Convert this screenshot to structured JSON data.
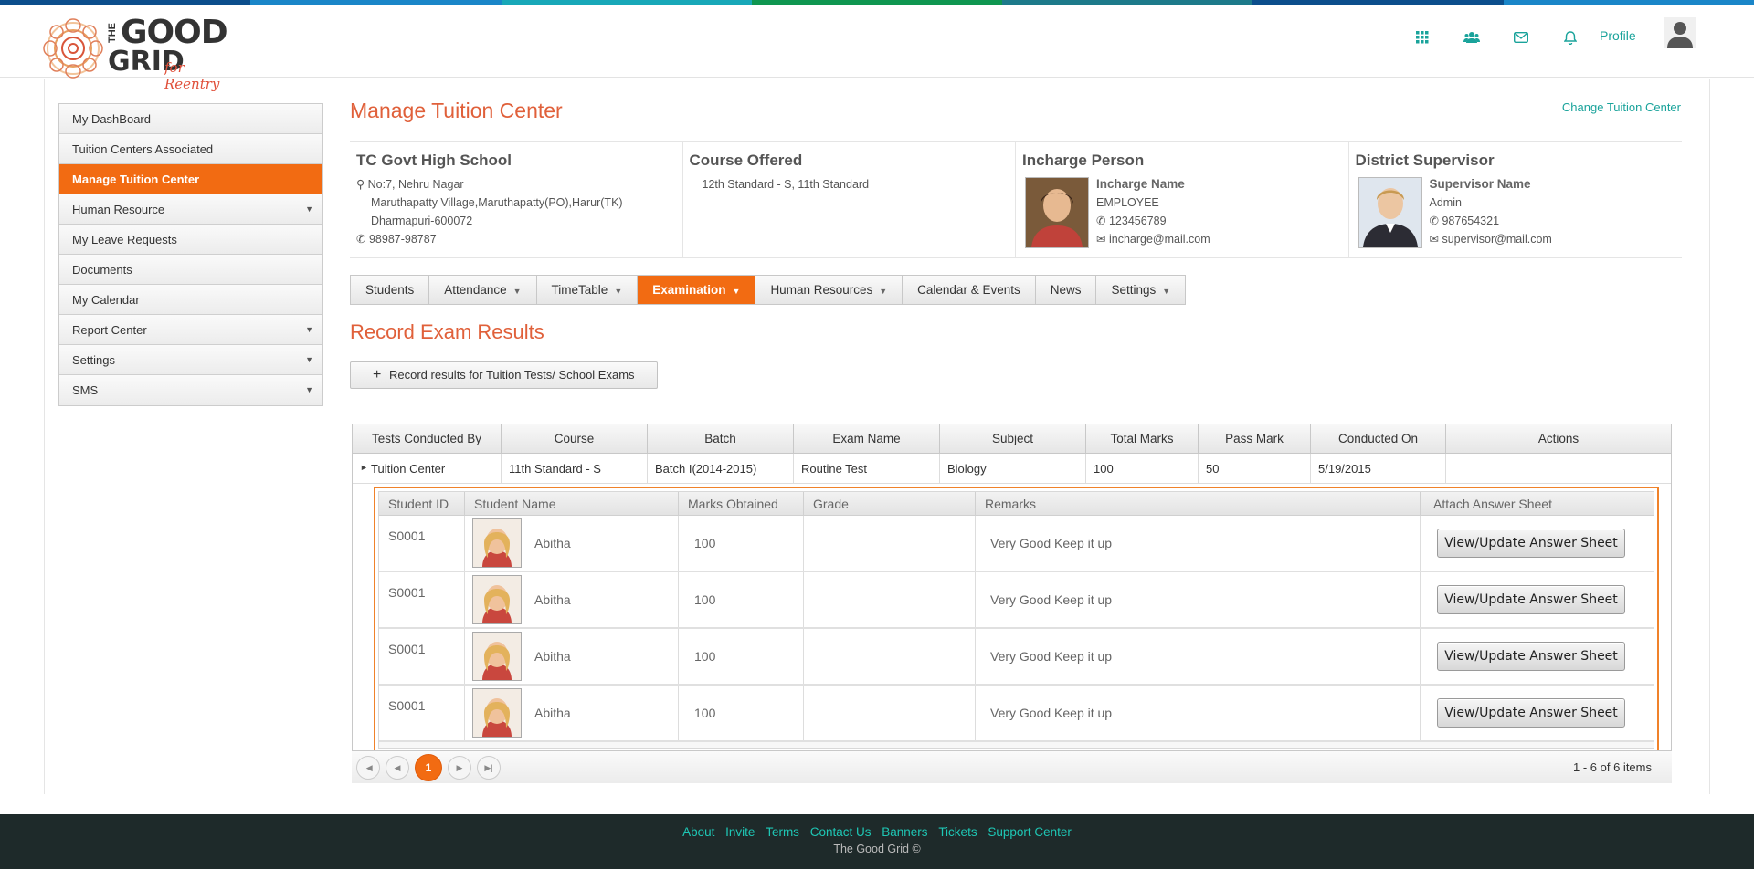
{
  "colors": {
    "accent": "#f26b12",
    "teal": "#1aa39b",
    "title": "#e0603a",
    "topbar": [
      "#0c4e8c",
      "#1a86c8",
      "#18a8b8",
      "#0f9650",
      "#1d7a8a"
    ]
  },
  "header": {
    "logo": {
      "the": "THE",
      "good": "GOOD",
      "grid": "GRID",
      "tag": "for Reentry"
    },
    "icons": [
      "apps-grid-icon",
      "users-icon",
      "mail-icon",
      "bell-icon"
    ],
    "profile_label": "Profile"
  },
  "sidebar": {
    "items": [
      {
        "label": "My DashBoard",
        "caret": false,
        "active": false
      },
      {
        "label": "Tuition Centers Associated",
        "caret": false,
        "active": false
      },
      {
        "label": "Manage Tuition Center",
        "caret": false,
        "active": true
      },
      {
        "label": "Human Resource",
        "caret": true,
        "active": false
      },
      {
        "label": "My Leave Requests",
        "caret": false,
        "active": false
      },
      {
        "label": "Documents",
        "caret": false,
        "active": false
      },
      {
        "label": "My Calendar",
        "caret": false,
        "active": false
      },
      {
        "label": "Report Center",
        "caret": true,
        "active": false
      },
      {
        "label": "Settings",
        "caret": true,
        "active": false
      },
      {
        "label": "SMS",
        "caret": true,
        "active": false
      }
    ]
  },
  "page": {
    "title": "Manage Tuition Center",
    "change_link": "Change Tuition Center"
  },
  "info": {
    "school": {
      "name": "TC Govt High School",
      "addr1": "No:7, Nehru Nagar",
      "addr2": "Maruthapatty Village,Maruthapatty(PO),Harur(TK)",
      "addr3": "Dharmapuri-600072",
      "phone": "98987-98787"
    },
    "course": {
      "heading": "Course Offered",
      "text": "12th Standard - S, 11th Standard"
    },
    "incharge": {
      "heading": "Incharge Person",
      "name": "Incharge Name",
      "role": "EMPLOYEE",
      "phone": "123456789",
      "email": "incharge@mail.com"
    },
    "supervisor": {
      "heading": "District Supervisor",
      "name": "Supervisor Name",
      "role": "Admin",
      "phone": "987654321",
      "email": "supervisor@mail.com"
    }
  },
  "tabs": [
    {
      "label": "Students",
      "dd": false,
      "active": false
    },
    {
      "label": "Attendance",
      "dd": true,
      "active": false
    },
    {
      "label": "TimeTable",
      "dd": true,
      "active": false
    },
    {
      "label": "Examination",
      "dd": true,
      "active": true
    },
    {
      "label": "Human Resources",
      "dd": true,
      "active": false
    },
    {
      "label": "Calendar & Events",
      "dd": false,
      "active": false
    },
    {
      "label": "News",
      "dd": false,
      "active": false
    },
    {
      "label": "Settings",
      "dd": true,
      "active": false
    }
  ],
  "section": {
    "title": "Record Exam Results",
    "record_button": "Record results for Tuition Tests/ School Exams"
  },
  "grid": {
    "headers": [
      "Tests Conducted By",
      "Course",
      "Batch",
      "Exam Name",
      "Subject",
      "Total Marks",
      "Pass Mark",
      "Conducted On",
      "Actions"
    ],
    "row": [
      "Tuition Center",
      "11th Standard - S",
      "Batch I(2014-2015)",
      "Routine Test",
      "Biology",
      "100",
      "50",
      "5/19/2015",
      ""
    ]
  },
  "detail": {
    "headers": [
      "Student ID",
      "Student Name",
      "Marks Obtained",
      "Grade",
      "Remarks",
      "Attach Answer Sheet"
    ],
    "rows": [
      {
        "id": "S0001",
        "name": "Abitha",
        "marks": "100",
        "grade": "",
        "remarks": "Very Good Keep it up",
        "button": "View/Update Answer Sheet"
      },
      {
        "id": "S0001",
        "name": "Abitha",
        "marks": "100",
        "grade": "",
        "remarks": "Very Good Keep it up",
        "button": "View/Update Answer Sheet"
      },
      {
        "id": "S0001",
        "name": "Abitha",
        "marks": "100",
        "grade": "",
        "remarks": "Very Good Keep it up",
        "button": "View/Update Answer Sheet"
      },
      {
        "id": "S0001",
        "name": "Abitha",
        "marks": "100",
        "grade": "",
        "remarks": "Very Good Keep it up",
        "button": "View/Update Answer Sheet"
      }
    ]
  },
  "pager": {
    "current": "1",
    "info": "1 - 6 of 6 items"
  },
  "footer": {
    "links": [
      "About",
      "Invite",
      "Terms",
      "Contact Us",
      "Banners",
      "Tickets",
      "Support Center"
    ],
    "copyright": "The Good Grid ©"
  }
}
